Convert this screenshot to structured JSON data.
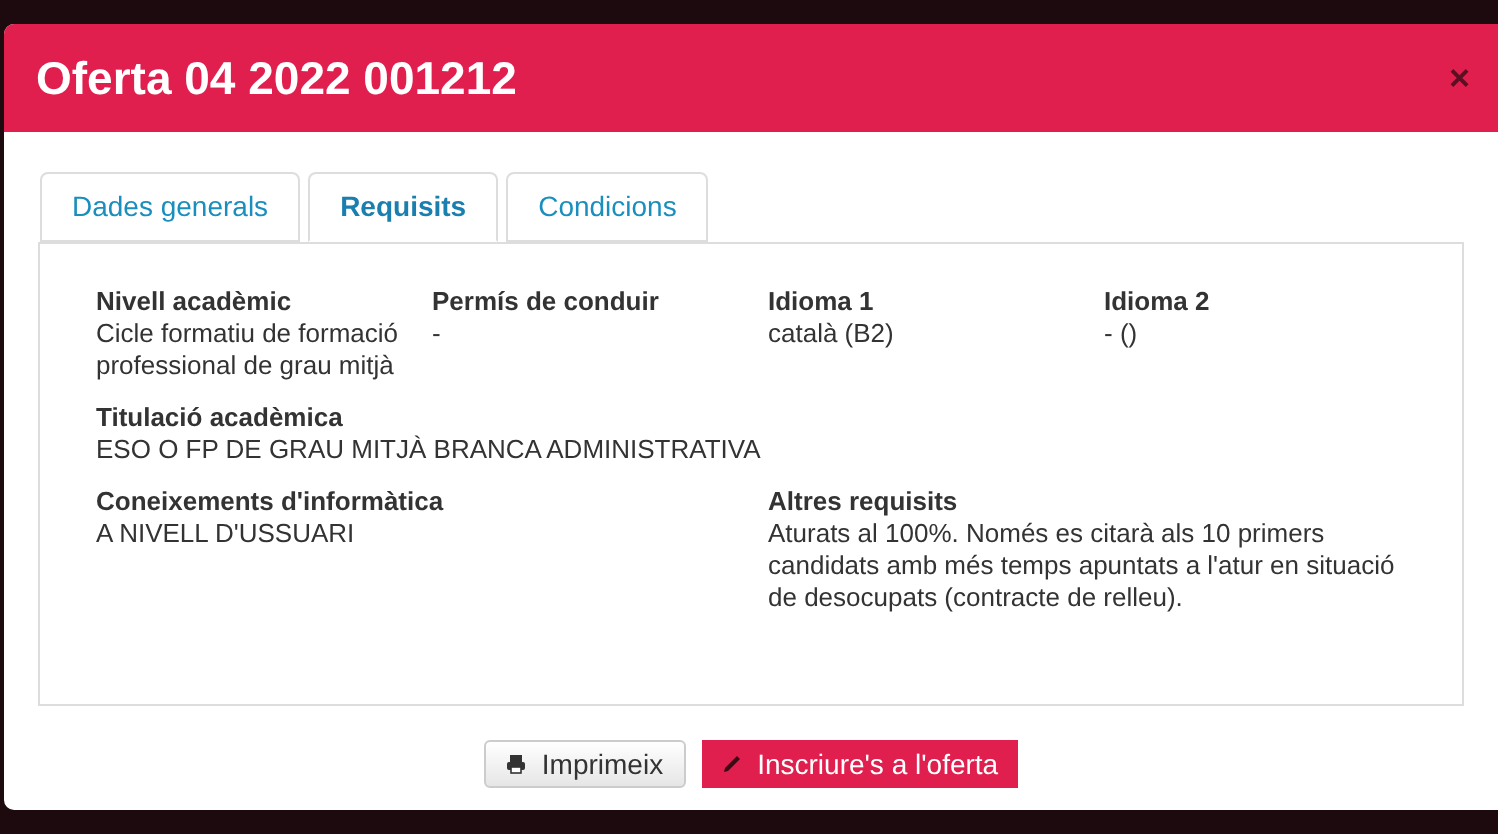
{
  "dialog": {
    "title": "Oferta 04 2022 001212",
    "close": "×"
  },
  "tabs": [
    {
      "label": "Dades generals",
      "selected": false
    },
    {
      "label": "Requisits",
      "selected": true
    },
    {
      "label": "Condicions",
      "selected": false
    }
  ],
  "rows": [
    [
      {
        "label": "Nivell acadèmic",
        "value": "Cicle formatiu de formació professional de grau mitjà"
      },
      {
        "label": "Permís de conduir",
        "value": "-"
      },
      {
        "label": "Idioma 1",
        "value": "català (B2)"
      },
      {
        "label": "Idioma 2",
        "value": "- ()"
      }
    ],
    [
      {
        "label": "Titulació acadèmica",
        "value": "ESO O FP DE GRAU MITJÀ BRANCA ADMINISTRATIVA"
      }
    ],
    [
      {
        "label": "Coneixements d'informàtica",
        "value": "A NIVELL D'USSUARI"
      },
      {
        "label": "Altres requisits",
        "value": "Aturats al 100%. Només es citarà als 10 primers candidats amb més temps apuntats a l'atur en situació de desocupats (contracte de relleu)."
      }
    ]
  ],
  "buttons": [
    {
      "label": "Imprimeix",
      "kind": "print"
    },
    {
      "label": "Inscriure's a l'oferta",
      "kind": "apply"
    }
  ]
}
